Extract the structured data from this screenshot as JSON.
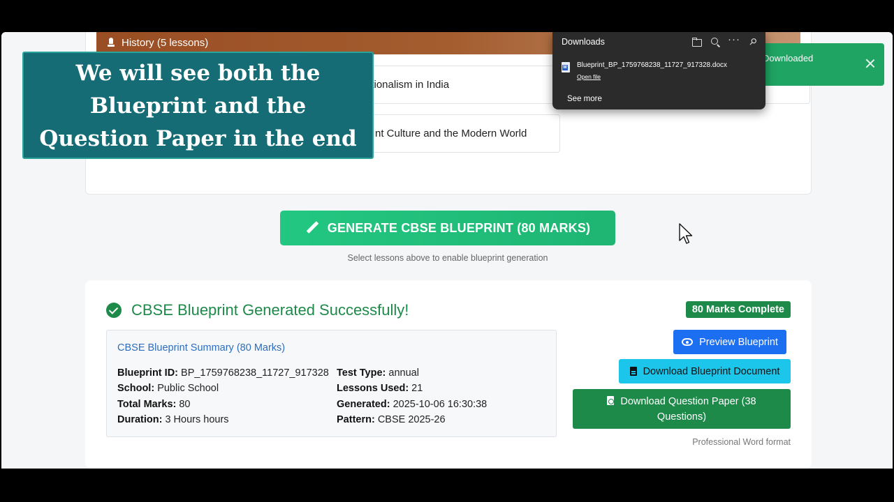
{
  "lessons_section": {
    "category_label": "History (5 lessons)",
    "items": [
      {
        "label": "ationalism in India"
      },
      {
        "label": "nt Culture and the Modern World"
      }
    ]
  },
  "caption_overlay": {
    "text_lines": [
      "We will see both the",
      "Blueprint and the",
      "Question Paper in the end"
    ]
  },
  "downloads_panel": {
    "title": "Downloads",
    "file_name": "Blueprint_BP_1759768238_11727_917328.docx",
    "open_link": "Open file",
    "see_more": "See more",
    "tool_icons": [
      "folder-icon",
      "search-icon",
      "more-icon",
      "pin-icon"
    ]
  },
  "toast": {
    "message": "Downloaded",
    "color": "#1fa463"
  },
  "generate": {
    "button_label": "GENERATE CBSE BLUEPRINT (80 MARKS)",
    "hint": "Select lessons above to enable blueprint generation"
  },
  "result": {
    "title": "CBSE Blueprint Generated Successfully!",
    "badge": "80 Marks Complete",
    "summary": {
      "heading": "CBSE Blueprint Summary (80 Marks)",
      "left": [
        {
          "key": "Blueprint ID:",
          "value": " BP_1759768238_11727_917328"
        },
        {
          "key": "School:",
          "value": " Public School"
        },
        {
          "key": "Total Marks:",
          "value": " 80"
        },
        {
          "key": "Duration:",
          "value": " 3 Hours hours"
        }
      ],
      "right": [
        {
          "key": "Test Type:",
          "value": " annual"
        },
        {
          "key": "Lessons Used:",
          "value": " 21"
        },
        {
          "key": "Generated:",
          "value": " 2025-10-06 16:30:38"
        },
        {
          "key": "Pattern:",
          "value": " CBSE 2025-26"
        }
      ]
    },
    "actions": {
      "preview": "Preview Blueprint",
      "download_doc": "Download Blueprint Document",
      "download_qp_line1": "Download Question Paper (38",
      "download_qp_line2": "Questions)",
      "format_note": "Professional Word format"
    }
  },
  "colors": {
    "success_green": "#1e8a4a",
    "primary_blue": "#1d6ff2",
    "info_cyan": "#1cc6ea",
    "generate_green": "#22c781",
    "caption_teal": "#166c74"
  }
}
